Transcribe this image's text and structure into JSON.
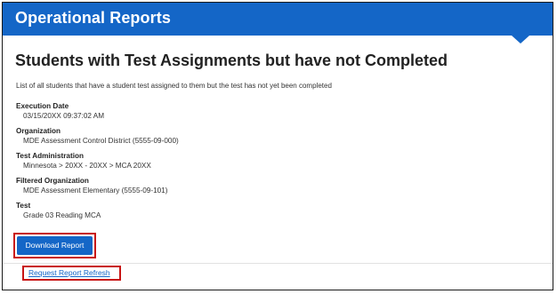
{
  "header": {
    "title": "Operational Reports",
    "accent_color": "#1466c7"
  },
  "report": {
    "title": "Students with Test Assignments but have not Completed",
    "description": "List of all students that have a student test assigned to them but the test has not yet been completed",
    "fields": [
      {
        "label": "Execution Date",
        "value": "03/15/20XX 09:37:02 AM"
      },
      {
        "label": "Organization",
        "value": "MDE Assessment Control District (5555-09-000)"
      },
      {
        "label": "Test Administration",
        "value": "Minnesota > 20XX - 20XX > MCA 20XX"
      },
      {
        "label": "Filtered Organization",
        "value": "MDE Assessment Elementary (5555-09-101)"
      },
      {
        "label": "Test",
        "value": "Grade 03 Reading MCA"
      }
    ]
  },
  "actions": {
    "download_label": "Download Report",
    "refresh_label": "Request Report Refresh",
    "highlight_color": "#c81414"
  }
}
